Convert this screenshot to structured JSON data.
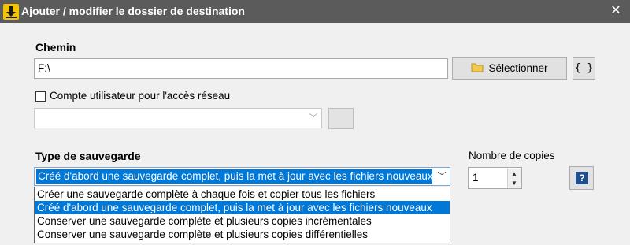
{
  "window": {
    "title": "Ajouter / modifier le dossier de destination",
    "close_symbol": "✕",
    "accent_color": "#0078d7",
    "titlebar_color": "#5b5b5b"
  },
  "path_section": {
    "label": "Chemin",
    "value": "F:\\",
    "select_button_label": "Sélectionner",
    "variables_button_label": "{ }"
  },
  "network": {
    "checkbox_label": "Compte utilisateur pour l'accès réseau",
    "checked": false,
    "account_value": ""
  },
  "backup_type": {
    "label": "Type de sauvegarde",
    "selected": "Créé d'abord une sauvegarde complet, puis la met à jour avec les fichiers nouveaux",
    "options": [
      "Créer une sauvegarde complète à chaque fois et copier tous les fichiers",
      "Créé d'abord une sauvegarde complet, puis la met à jour avec les fichiers nouveaux",
      "Conserver une sauvegarde complète et plusieurs copies incrémentales",
      "Conserver une sauvegarde complète et plusieurs copies différentielles"
    ],
    "selected_index": 1
  },
  "copies": {
    "label": "Nombre de copies",
    "value": "1",
    "help_label": "?"
  },
  "icons": [
    "app-icon",
    "close-icon",
    "folder-icon",
    "chevron-down-icon",
    "spin-up-icon",
    "spin-down-icon",
    "help-icon"
  ]
}
